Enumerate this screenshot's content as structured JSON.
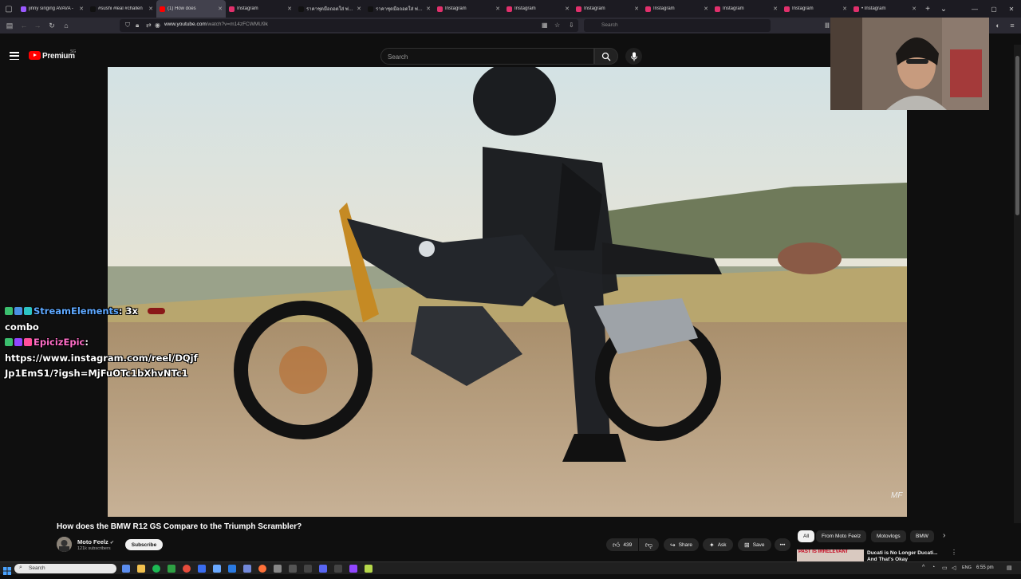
{
  "browser": {
    "tabs": [
      {
        "title": "jinny singing AVAVA -",
        "favicon_color": "#9b59ff"
      },
      {
        "title": "#sushi #leal #challen",
        "favicon_color": "#111111"
      },
      {
        "title": "(1) How does",
        "favicon_color": "#ff0000",
        "active": true
      },
      {
        "title": "Instagram",
        "favicon_color": "#e1306c"
      },
      {
        "title": "ราคาชุดมือถอดใส่ พ่อค้า",
        "favicon_color": "#111111"
      },
      {
        "title": "ราคาชุดมือถอดใส่ พ่อค้า",
        "favicon_color": "#111111"
      },
      {
        "title": "Instagram",
        "favicon_color": "#e1306c"
      },
      {
        "title": "Instagram",
        "favicon_color": "#e1306c"
      },
      {
        "title": "Instagram",
        "favicon_color": "#e1306c"
      },
      {
        "title": "Instagram",
        "favicon_color": "#e1306c"
      },
      {
        "title": "Instagram",
        "favicon_color": "#e1306c"
      },
      {
        "title": "Instagram",
        "favicon_color": "#e1306c"
      },
      {
        "title": "• Instagram",
        "favicon_color": "#e1306c"
      }
    ],
    "url_domain": "www.youtube.com",
    "url_path": "/watch?v=m14zFCWMU9k",
    "search_placeholder": "Search"
  },
  "youtube": {
    "brand": "Premium",
    "country_code": "SG",
    "search_placeholder": "Search",
    "video_title": "How does the BMW R12 GS Compare to the Triumph Scrambler?",
    "channel_name": "Moto Feelz",
    "channel_subs": "121k subscribers",
    "subscribe_label": "Subscribe",
    "like_count": "439",
    "share_label": "Share",
    "ask_label": "Ask",
    "save_label": "Save",
    "more_label": "•••",
    "chips": [
      "All",
      "From Moto Feelz",
      "Motovlogs",
      "BMW"
    ],
    "rec_title": "Ducati is No Longer Ducati... And That's Okay",
    "rec_thumb_text": "PAST IS IRRELEVANT",
    "watermark": "MF"
  },
  "chat": {
    "line1_user": "StreamElements",
    "line1_msg": ": 3x",
    "line1_cont": "combo",
    "line2_user": "EpicizEpic",
    "line2_msg": ":",
    "line2_link1": "https://www.instagram.com/reel/DQjf",
    "line2_link2": "Jp1EmS1/?igsh=MjFuOTc1bXhvNTc1"
  },
  "taskbar": {
    "search_placeholder": "Search",
    "lang": "ENG",
    "time": "6:55 pm"
  },
  "colors": {
    "youtube_red": "#ff0000",
    "background": "#0f0f0f",
    "chat_user1": "#5ea8ff",
    "chat_user2": "#ff6ec7"
  }
}
